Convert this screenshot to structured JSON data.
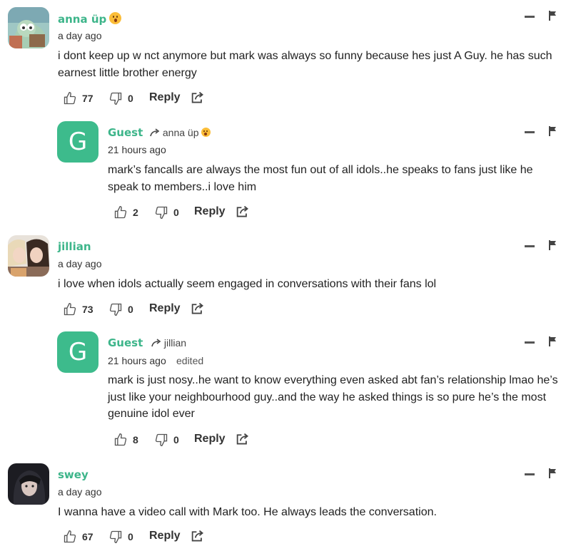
{
  "comments": [
    {
      "author": "anna üp",
      "time": "a day ago",
      "text": "i dont keep up w nct anymore but mark was always so funny because hes just A Guy. he has such earnest little brother energy",
      "likes": "77",
      "dislikes": "0",
      "reply_label": "Reply"
    },
    {
      "author": "Guest",
      "avatar_letter": "G",
      "reply_to": "anna üp",
      "time": "21 hours ago",
      "text": "mark’s fancalls are always the most fun out of all idols..he speaks to fans just like he speak to members..i love him",
      "likes": "2",
      "dislikes": "0",
      "reply_label": "Reply"
    },
    {
      "author": "jillian",
      "time": "a day ago",
      "text": "i love when idols actually seem engaged in conversations with their fans lol",
      "likes": "73",
      "dislikes": "0",
      "reply_label": "Reply"
    },
    {
      "author": "Guest",
      "avatar_letter": "G",
      "reply_to": "jillian",
      "time": "21 hours ago",
      "edited": "edited",
      "text": "mark is just nosy..he want to know everything even asked abt fan’s relationship lmao he’s just like your neighbourhood guy..and the way he asked things is so pure he’s the most genuine idol ever",
      "likes": "8",
      "dislikes": "0",
      "reply_label": "Reply"
    },
    {
      "author": "swey",
      "time": "a day ago",
      "text": "I wanna have a video call with Mark too. He always leads the conversation.",
      "likes": "67",
      "dislikes": "0",
      "reply_label": "Reply"
    }
  ],
  "icons": {
    "like": "thumbs-up-icon",
    "dislike": "thumbs-down-icon",
    "share": "share-icon",
    "collapse": "minus-icon",
    "flag": "flag-icon",
    "reply_arrow": "reply-arrow-icon",
    "emoji": "astonished-face-emoji"
  },
  "colors": {
    "author_name": "#3db58a",
    "guest_avatar": "#3dbb8c",
    "text": "#222222",
    "icon": "#555555"
  }
}
